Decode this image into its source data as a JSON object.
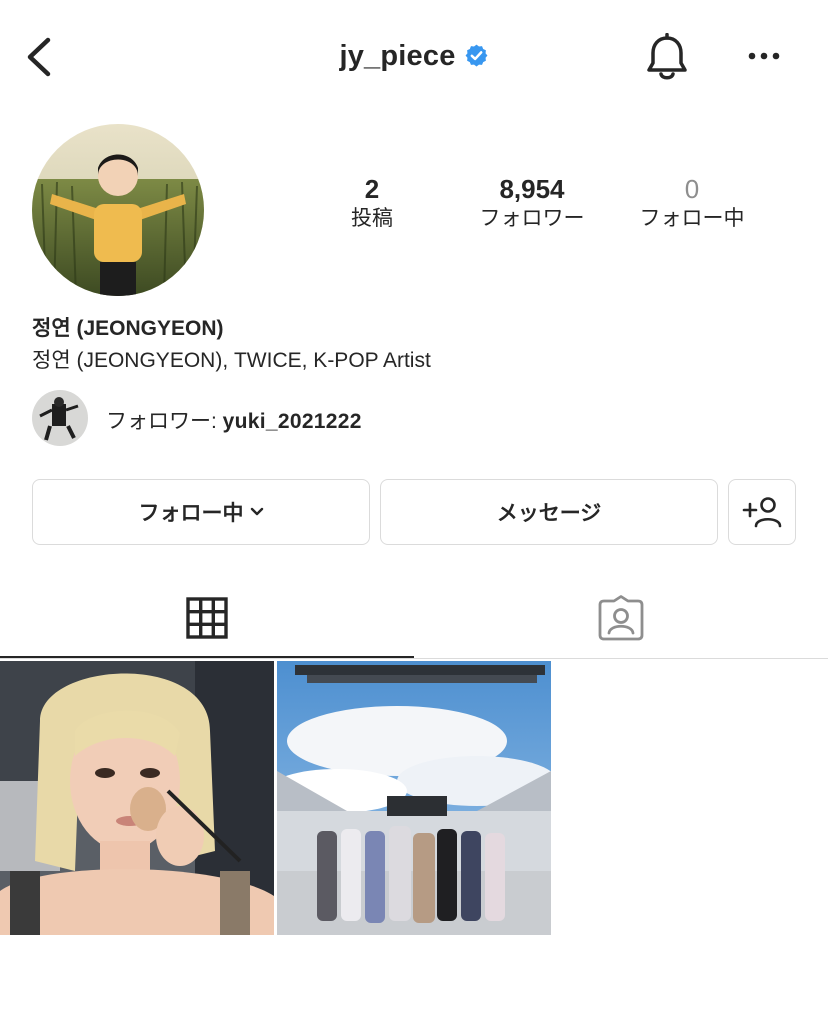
{
  "header": {
    "username": "jy_piece",
    "back_icon": "chevron-left-icon",
    "verified_icon": "verified-badge-icon",
    "bell_icon": "bell-icon",
    "more_icon": "more-horizontal-icon"
  },
  "stats": [
    {
      "value": "2",
      "label": "投稿"
    },
    {
      "value": "8,954",
      "label": "フォロワー"
    },
    {
      "value": "0",
      "label": "フォロー中"
    }
  ],
  "bio": {
    "name": "정연 (JEONGYEON)",
    "description": "정연 (JEONGYEON), TWICE, K-POP Artist"
  },
  "followed_by": {
    "prefix": "フォロワー: ",
    "username": "yuki_2021222"
  },
  "buttons": {
    "following": "フォロー中",
    "message": "メッセージ",
    "add_user_icon": "add-user-icon"
  },
  "tabs": {
    "grid_icon": "grid-icon",
    "tagged_icon": "tagged-person-icon"
  },
  "colors": {
    "verified": "#3897f0",
    "text": "#262626",
    "muted": "#8e8e8e",
    "border": "#dbdbdb"
  }
}
